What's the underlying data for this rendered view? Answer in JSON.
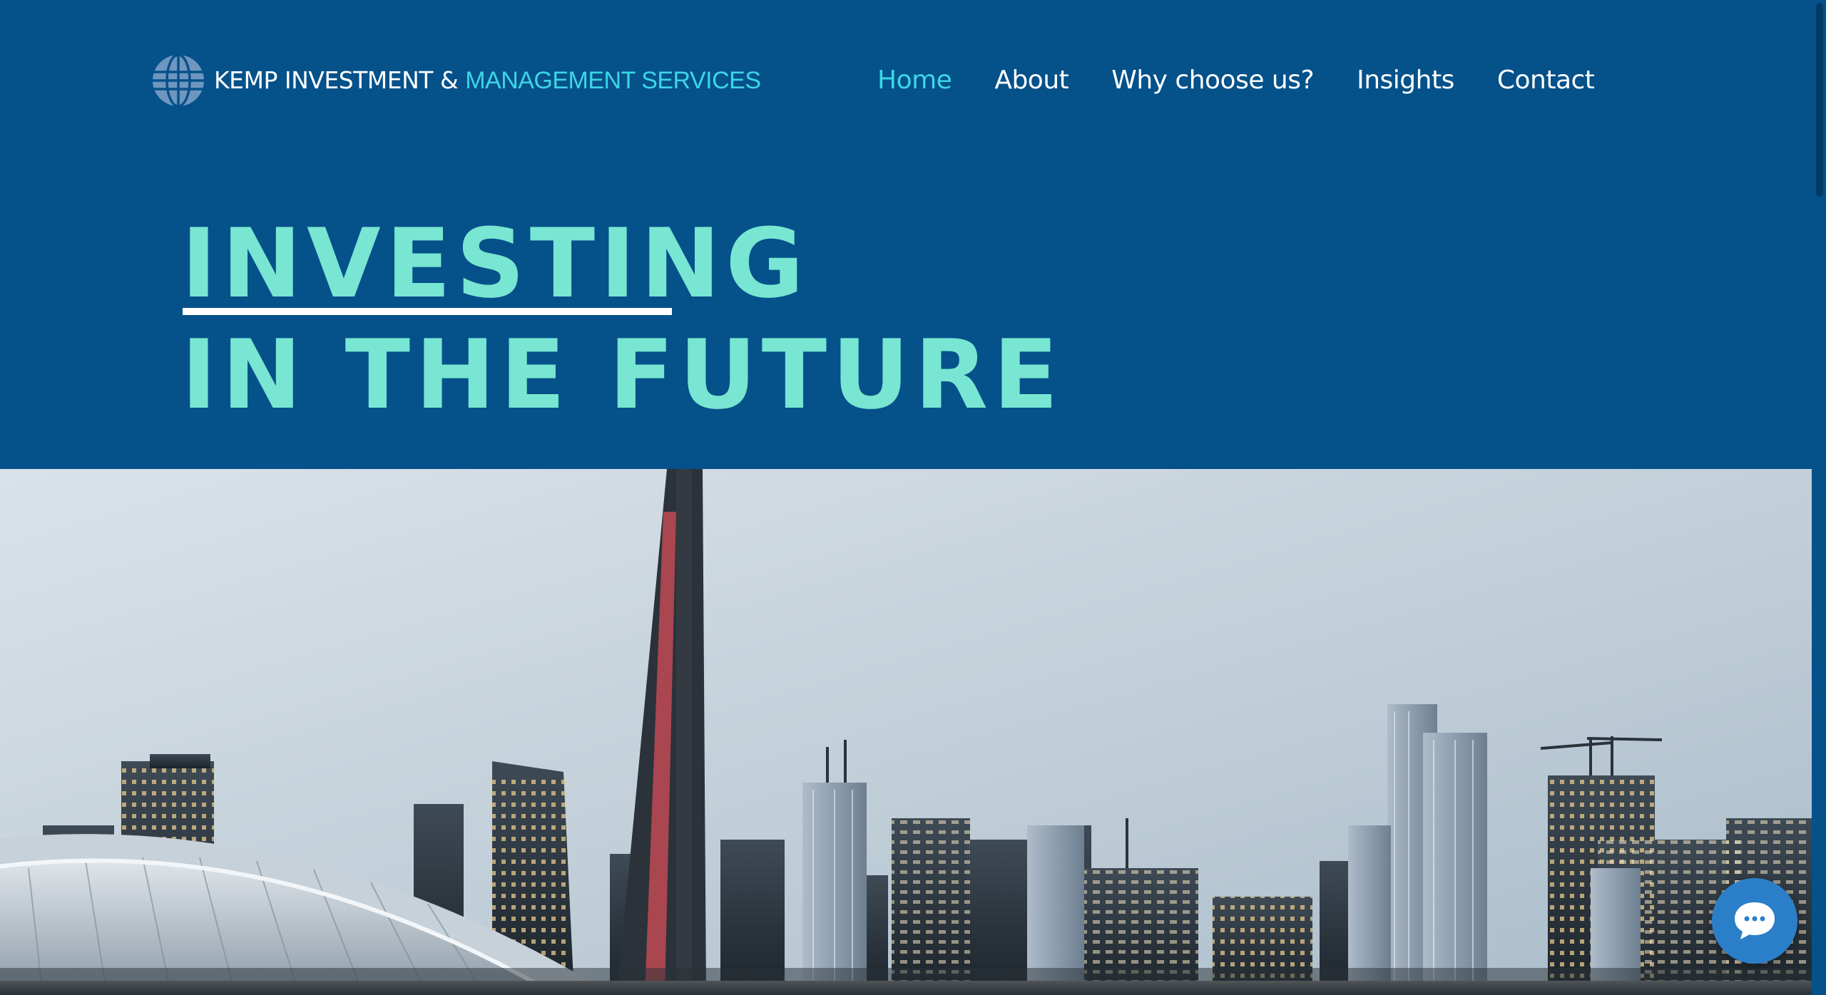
{
  "brand": {
    "name_part1": "KEMP INVESTMENT & ",
    "name_part2": "MANAGEMENT SERVICES",
    "logo_icon": "globe-icon"
  },
  "nav": {
    "items": [
      {
        "label": "Home",
        "active": true
      },
      {
        "label": "About",
        "active": false
      },
      {
        "label": "Why choose us?",
        "active": false
      },
      {
        "label": "Insights",
        "active": false
      },
      {
        "label": "Contact",
        "active": false
      }
    ]
  },
  "hero": {
    "line1": "INVESTING",
    "line2": "IN THE FUTURE",
    "image": "city-skyline-with-tower-photo"
  },
  "chat": {
    "icon": "chat-bubble-icon"
  },
  "colors": {
    "background": "#05518a",
    "accent": "#3cd6e6",
    "hero_text": "#78e6d2",
    "chat_button": "#2b7fc9"
  }
}
